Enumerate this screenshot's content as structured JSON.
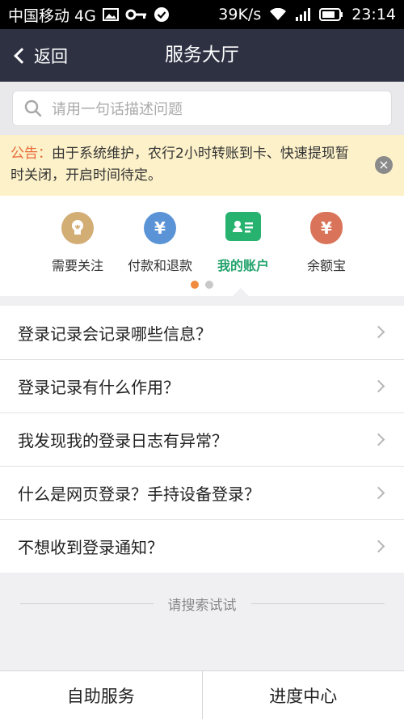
{
  "status": {
    "carrier": "中国移动 4G",
    "speed": "39K/s",
    "time": "23:14"
  },
  "nav": {
    "back_label": "返回",
    "title": "服务大厅"
  },
  "search": {
    "placeholder": "请用一句话描述问题"
  },
  "notice": {
    "tag": "公告：",
    "text": "由于系统维护，农行2小时转账到卡、快速提现暂时关闭，开启时间待定。",
    "close_glyph": "×"
  },
  "categories": [
    {
      "label": "需要关注",
      "icon": "bulb-icon",
      "color": "#caa36a"
    },
    {
      "label": "付款和退款",
      "icon": "yen-icon",
      "color": "#5b94d6"
    },
    {
      "label": "我的账户",
      "icon": "id-card-icon",
      "color": "#27b36f",
      "active": true
    },
    {
      "label": "余额宝",
      "icon": "money-bag-icon",
      "color": "#d9745a"
    }
  ],
  "glyphs": {
    "yen": "¥"
  },
  "questions": [
    "登录记录会记录哪些信息？",
    "登录记录有什么作用？",
    "我发现我的登录日志有异常？",
    "什么是网页登录？手持设备登录？",
    "不想收到登录通知？"
  ],
  "hint": "请搜索试试",
  "bottom": {
    "self_service": "自助服务",
    "progress": "进度中心"
  }
}
